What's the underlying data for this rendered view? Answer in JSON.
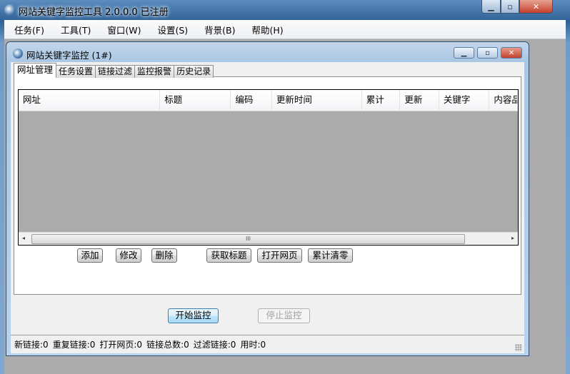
{
  "window": {
    "title": "网站关键字监控工具 2.0.0.0  已注册",
    "min": "▁",
    "max": "▫",
    "close": "✕"
  },
  "menu": [
    "任务(F)",
    "工具(T)",
    "窗口(W)",
    "设置(S)",
    "背景(B)",
    "帮助(H)"
  ],
  "child": {
    "title": "网站关键字监控  (1#)",
    "min": "▁",
    "max": "▫",
    "close": "✕"
  },
  "tabs": [
    "网址管理",
    "任务设置",
    "链接过滤",
    "监控报警",
    "历史记录"
  ],
  "table": {
    "columns": [
      "网址",
      "标题",
      "编码",
      "更新时间",
      "累计",
      "更新",
      "关键字",
      "内容品"
    ]
  },
  "scroll": {
    "left": "◂",
    "right": "▸",
    "thumb": "III"
  },
  "buttons": {
    "add": "添加",
    "edit": "修改",
    "delete": "删除",
    "get_title": "获取标题",
    "open_page": "打开网页",
    "reset_count": "累计清零",
    "start": "开始监控",
    "stop": "停止监控"
  },
  "status": [
    "新链接:0",
    "重复链接:0",
    "打开网页:0",
    "链接总数:0",
    "过滤链接:0",
    "用时:0"
  ]
}
